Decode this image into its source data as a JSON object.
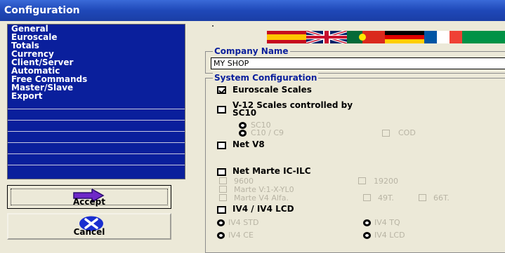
{
  "window": {
    "title": "Configuration"
  },
  "menu": {
    "items": [
      "General",
      "Euroscale",
      "Totals",
      "Currency",
      "Client/Server",
      "Automatic",
      "Free Commands",
      "Master/Slave",
      "Export"
    ]
  },
  "buttons": {
    "accept_label": "Accept",
    "cancel_label": "Cancel"
  },
  "icons": {
    "accept": "right-arrow-icon",
    "cancel": "cancel-x-icon"
  },
  "flags": [
    "spain-flag",
    "uk-flag",
    "portugal-flag",
    "germany-flag",
    "france-flag",
    "italy-flag"
  ],
  "company": {
    "title": "Company Name",
    "value": "MY SHOP"
  },
  "system": {
    "title": "System Configuration",
    "euroscale": {
      "label": "Euroscale Scales",
      "checked": true
    },
    "v12": {
      "label_line1": "V-12 Scales controlled  by",
      "label_line2": "SC10",
      "checked": false,
      "sc10": "SC10",
      "c10c9": "C10 / C9",
      "cod": "COD"
    },
    "netv8": {
      "label": "Net V8",
      "checked": false
    },
    "netmarte": {
      "label": "Net Marte IC-ILC",
      "checked": false,
      "baud9600": "9600",
      "baud19200": "19200",
      "marte_v1": "Marte V:1-X-YL0",
      "marte_v4": "Marte V4 Alfa.",
      "t49": "49T.",
      "t66": "66T."
    },
    "iv4": {
      "label": "IV4 / IV4 LCD",
      "checked": false,
      "std": "IV4 STD",
      "tq": "IV4 TQ",
      "ce": "IV4 CE",
      "lcd": "IV4 LCD"
    }
  },
  "colors": {
    "menu_bg": "#0a1f9c",
    "title_bar": "#1f48b8",
    "group_title": "#0a1f9c",
    "window_bg": "#ece9d8"
  }
}
